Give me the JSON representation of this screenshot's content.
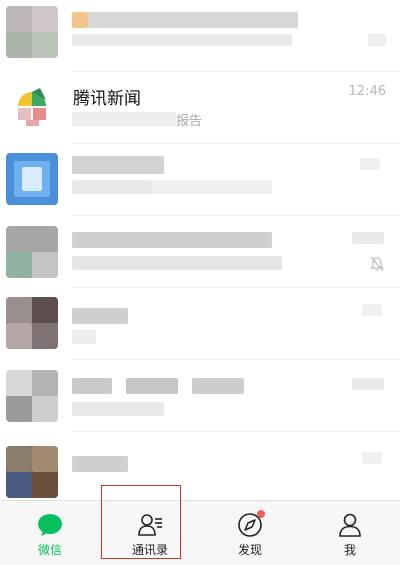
{
  "chats": [
    {
      "title": "",
      "time": "",
      "preview": ""
    },
    {
      "title": "腾讯新闻",
      "time": "12:46",
      "preview": "报告"
    },
    {
      "title": "",
      "time": "",
      "preview": ""
    },
    {
      "title": "",
      "time": "",
      "preview": ""
    },
    {
      "title": "",
      "time": "",
      "preview": ""
    },
    {
      "title": "",
      "time": "",
      "preview": ""
    },
    {
      "title": "",
      "time": "",
      "preview": ""
    }
  ],
  "tabbar": {
    "tabs": [
      {
        "label": "微信",
        "icon": "chat-bubble-icon",
        "active": true
      },
      {
        "label": "通讯录",
        "icon": "contacts-icon",
        "active": false
      },
      {
        "label": "发现",
        "icon": "compass-icon",
        "active": false
      },
      {
        "label": "我",
        "icon": "person-icon",
        "active": false
      }
    ],
    "active_color": "#07c160",
    "highlight_color": "#c0392b",
    "badge_color": "#f25f5c"
  }
}
